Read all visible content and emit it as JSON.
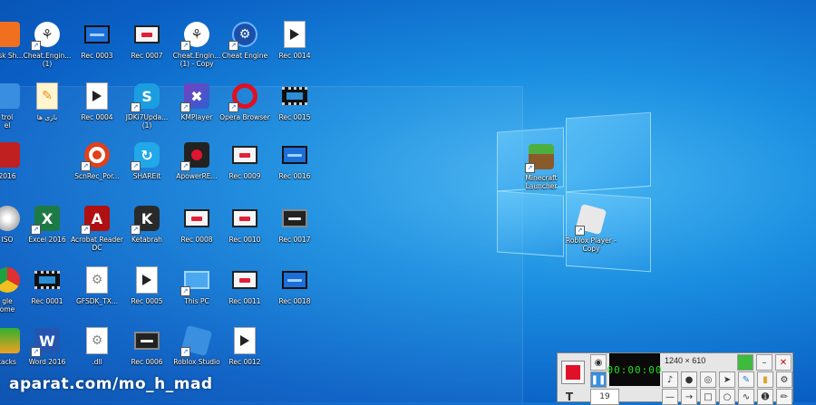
{
  "desktop": {
    "icons": [
      {
        "label": "Disk Sh...",
        "kind": "orange",
        "col": 0,
        "row": 0
      },
      {
        "label": "trol\nel",
        "kind": "panel",
        "col": 0,
        "row": 1
      },
      {
        "label": "2016",
        "kind": "redbox",
        "col": 0,
        "row": 2
      },
      {
        "label": "ISO",
        "kind": "disc",
        "col": 0,
        "row": 3
      },
      {
        "label": "gle\nome",
        "kind": "chrome",
        "col": 0,
        "row": 4
      },
      {
        "label": "tacks",
        "kind": "stack",
        "col": 0,
        "row": 5
      },
      {
        "label": "Cheat.Engin...\n(1)",
        "kind": "ce",
        "col": 1,
        "row": 0
      },
      {
        "label": "بازی ها",
        "kind": "folderdoc",
        "col": 1,
        "row": 1
      },
      {
        "label": "Excel 2016",
        "kind": "excel",
        "col": 1,
        "row": 3
      },
      {
        "label": "Rec 0001",
        "kind": "film",
        "col": 1,
        "row": 4
      },
      {
        "label": "Word 2016",
        "kind": "word",
        "col": 1,
        "row": 5
      },
      {
        "label": "Rec 0003",
        "kind": "scrblue",
        "col": 2,
        "row": 0
      },
      {
        "label": "Rec 0004",
        "kind": "doc",
        "col": 2,
        "row": 1
      },
      {
        "label": "ScnRec_Por...",
        "kind": "scnrec",
        "col": 2,
        "row": 2
      },
      {
        "label": "Acrobat Reader DC",
        "kind": "acrobat",
        "col": 2,
        "row": 3
      },
      {
        "label": "GFSDK_TX...",
        "kind": "gear",
        "col": 2,
        "row": 4
      },
      {
        "label": ".dll",
        "kind": "gear",
        "col": 2,
        "row": 5
      },
      {
        "label": "Rec 0007",
        "kind": "scr",
        "col": 3,
        "row": 0
      },
      {
        "label": "JDKi7Upda...\n(1)",
        "kind": "skype",
        "col": 3,
        "row": 1
      },
      {
        "label": "SHAREit",
        "kind": "shareit",
        "col": 3,
        "row": 2
      },
      {
        "label": "Ketabrah",
        "kind": "ketab",
        "col": 3,
        "row": 3
      },
      {
        "label": "Rec 0005",
        "kind": "doc",
        "col": 3,
        "row": 4
      },
      {
        "label": "Rec 0006",
        "kind": "scrdark",
        "col": 3,
        "row": 5
      },
      {
        "label": "Cheat.Engin...\n(1) - Copy",
        "kind": "ce",
        "col": 4,
        "row": 0
      },
      {
        "label": "KMPlayer",
        "kind": "km",
        "col": 4,
        "row": 1
      },
      {
        "label": "ApowerRE...",
        "kind": "apower",
        "col": 4,
        "row": 2
      },
      {
        "label": "Rec 0008",
        "kind": "scr",
        "col": 4,
        "row": 3
      },
      {
        "label": "This PC",
        "kind": "pc",
        "col": 4,
        "row": 4
      },
      {
        "label": "Roblox Studio",
        "kind": "robloxstudio",
        "col": 4,
        "row": 5
      },
      {
        "label": "Cheat Engine",
        "kind": "cheatengine",
        "col": 5,
        "row": 0
      },
      {
        "label": "Opera Browser",
        "kind": "opera",
        "col": 5,
        "row": 1
      },
      {
        "label": "Rec 0009",
        "kind": "scr",
        "col": 5,
        "row": 2
      },
      {
        "label": "Rec 0010",
        "kind": "scr",
        "col": 5,
        "row": 3
      },
      {
        "label": "Rec 0011",
        "kind": "scr",
        "col": 5,
        "row": 4
      },
      {
        "label": "Rec 0012",
        "kind": "doc",
        "col": 5,
        "row": 5
      },
      {
        "label": "Rec 0014",
        "kind": "doc",
        "col": 6,
        "row": 0
      },
      {
        "label": "Rec 0015",
        "kind": "film",
        "col": 6,
        "row": 1
      },
      {
        "label": "Rec 0016",
        "kind": "scrblue",
        "col": 6,
        "row": 2
      },
      {
        "label": "Rec 0017",
        "kind": "scrdark",
        "col": 6,
        "row": 3
      },
      {
        "label": "Rec 0018",
        "kind": "scrblue",
        "col": 6,
        "row": 4
      }
    ],
    "extra_icons": [
      {
        "label": "Minecraft Launcher",
        "kind": "minecraft"
      },
      {
        "label": "Roblox Player - Copy",
        "kind": "roblox"
      }
    ]
  },
  "watermark": "aparat.com/mo_h_mad",
  "recorder": {
    "size_text": "1240 × 610",
    "timer": "00:00:00",
    "font_size": "19",
    "text_tool": "T"
  }
}
